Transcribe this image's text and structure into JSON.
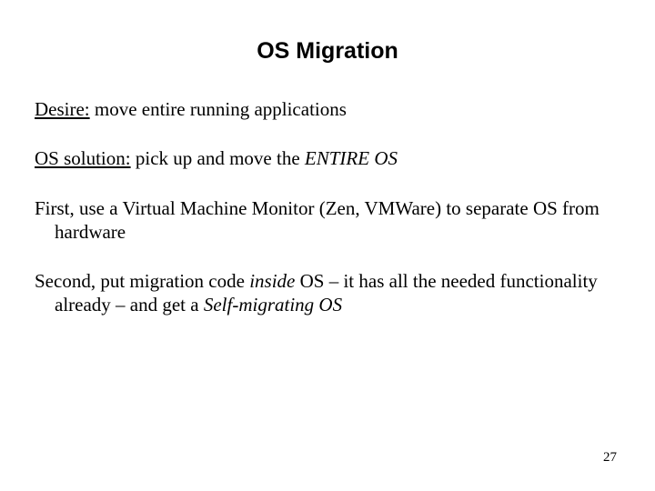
{
  "title": "OS Migration",
  "paragraphs": {
    "p1_a": "Desire:",
    "p1_b": " move entire running applications",
    "p2_a": "OS solution:",
    "p2_b": " pick up and move the ",
    "p2_c": "ENTIRE OS",
    "p3": "First, use a Virtual Machine Monitor (Zen, VMWare) to separate OS from hardware",
    "p4_a": "Second, put migration code ",
    "p4_b": "inside",
    "p4_c": " OS – it has all the needed functionality already – and get a ",
    "p4_d": "Self-migrating OS"
  },
  "page_number": "27"
}
